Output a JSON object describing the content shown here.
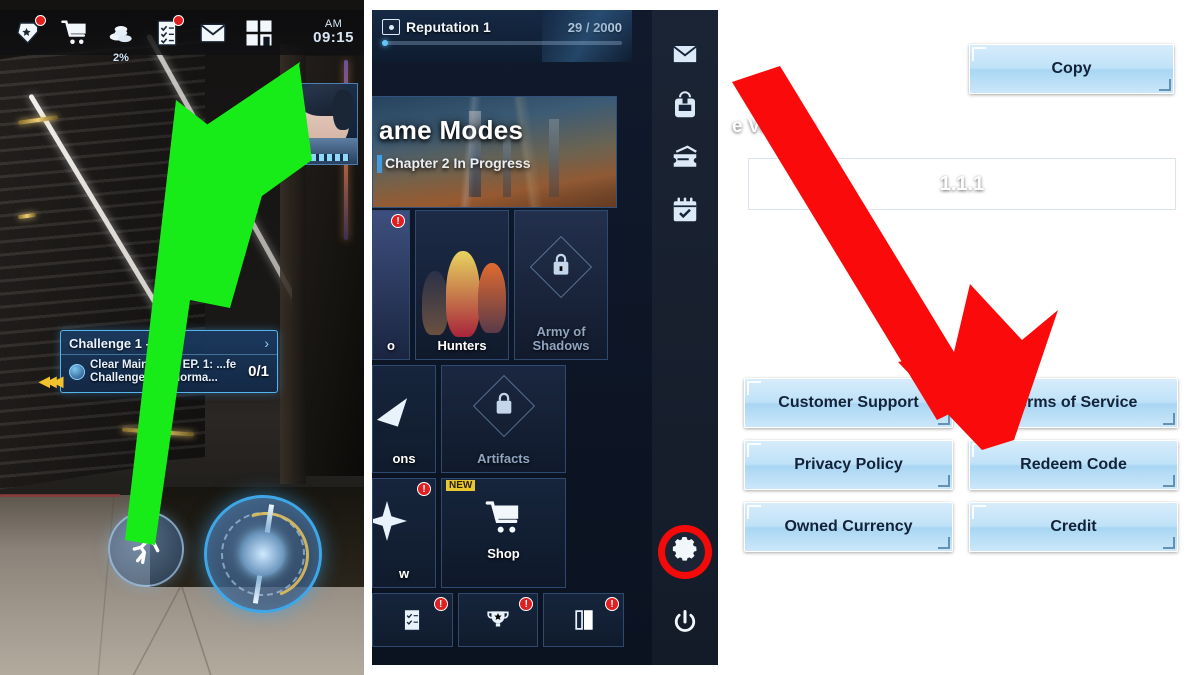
{
  "panel1": {
    "hud_icons": [
      {
        "name": "gacha-ticket-icon",
        "badge": true
      },
      {
        "name": "shop-cart-icon",
        "badge": false
      },
      {
        "name": "coins-icon",
        "badge": false,
        "label": "2%"
      },
      {
        "name": "mission-checklist-icon",
        "badge": true
      },
      {
        "name": "mail-envelope-icon",
        "badge": false
      },
      {
        "name": "menu-grid-icon",
        "badge": false
      }
    ],
    "clock": {
      "ampm": "AM",
      "time": "09:15"
    },
    "challenge": {
      "title": "Challenge 1 - 1",
      "arrow": "›",
      "description": "Clear Main Ch. 3 EP. 1: ...fe Challenges on Norma...",
      "count": "0/1"
    },
    "controls": {
      "run_button": "sprint-icon",
      "joystick": "virtual-joystick"
    },
    "annotation": {
      "arrow_color": "#18ec18",
      "points_to": "menu-grid-icon"
    }
  },
  "panel2": {
    "reputation": {
      "icon": "reputation-card-icon",
      "label": "Reputation 1",
      "value": "29 / 2000",
      "progress_pct": 1.45
    },
    "banner": {
      "title": "ame Modes",
      "subtitle": "Chapter 2 In Progress"
    },
    "tiles": [
      {
        "label": "o",
        "locked": false,
        "badge": "!",
        "cut": true
      },
      {
        "label": "Hunters",
        "locked": false,
        "badge": null,
        "cut": false
      },
      {
        "label": "Army of Shadows",
        "locked": true,
        "badge": null,
        "cut": false
      },
      {
        "label": "ons",
        "locked": false,
        "badge": null,
        "cut": true
      },
      {
        "label": "Artifacts",
        "locked": true,
        "badge": null,
        "cut": false
      },
      {
        "label": "w",
        "locked": false,
        "badge": "!",
        "cut": true
      },
      {
        "label": "Shop",
        "locked": false,
        "badge": null,
        "new": "NEW",
        "icon": "shop-cart-icon"
      }
    ],
    "mini_tiles": [
      {
        "icon": "mission-checklist-icon",
        "badge": "!"
      },
      {
        "icon": "trophy-icon",
        "badge": "!"
      },
      {
        "icon": "book-icon",
        "badge": "!"
      }
    ],
    "sidebar": [
      {
        "name": "mail-envelope-icon"
      },
      {
        "name": "backpack-icon"
      },
      {
        "name": "ticket-icon"
      },
      {
        "name": "calendar-check-icon"
      }
    ],
    "settings_gear": {
      "name": "gear-icon",
      "highlight_color": "#f50a0a"
    },
    "power_button": {
      "name": "power-icon"
    }
  },
  "panel3": {
    "copy_button": "Copy",
    "version_label": "e Version",
    "version_value": "1.1.1",
    "buttons": [
      "Customer Support",
      "Terms of Service",
      "Privacy Policy",
      "Redeem Code",
      "Owned Currency",
      "Credit"
    ],
    "annotation": {
      "arrow_color": "#fa0a0a",
      "points_to": "Redeem Code"
    }
  }
}
